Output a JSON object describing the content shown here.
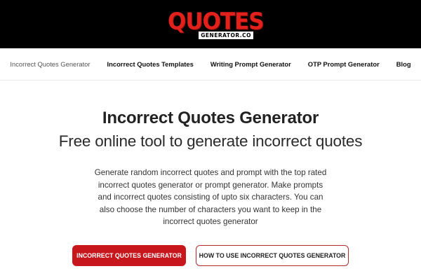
{
  "header": {
    "logo_main": "QUOTES",
    "logo_sub": "GENERATOR.CO"
  },
  "nav": {
    "items": [
      {
        "label": "Incorrect Quotes Generator",
        "active": true
      },
      {
        "label": "Incorrect Quotes Templates",
        "active": false
      },
      {
        "label": "Writing Prompt Generator",
        "active": false
      },
      {
        "label": "OTP Prompt Generator",
        "active": false
      },
      {
        "label": "Blog",
        "active": false
      }
    ]
  },
  "hero": {
    "title": "Incorrect Quotes Generator",
    "subtitle": "Free online tool to generate incorrect quotes",
    "description": "Generate random incorrect quotes and prompt with the top rated incorrect quotes generator or prompt generator. Make prompts and incorrect quotes consisting of upto six characters. You can also choose the number of characters you want to keep in the incorrect quotes generator",
    "primary_button": "INCORRECT QUOTES GENERATOR",
    "secondary_button": "HOW TO USE INCORRECT QUOTES GENERATOR"
  },
  "colors": {
    "header_bg": "#000000",
    "brand_red": "#c8161d",
    "logo_red": "#e3211c"
  }
}
